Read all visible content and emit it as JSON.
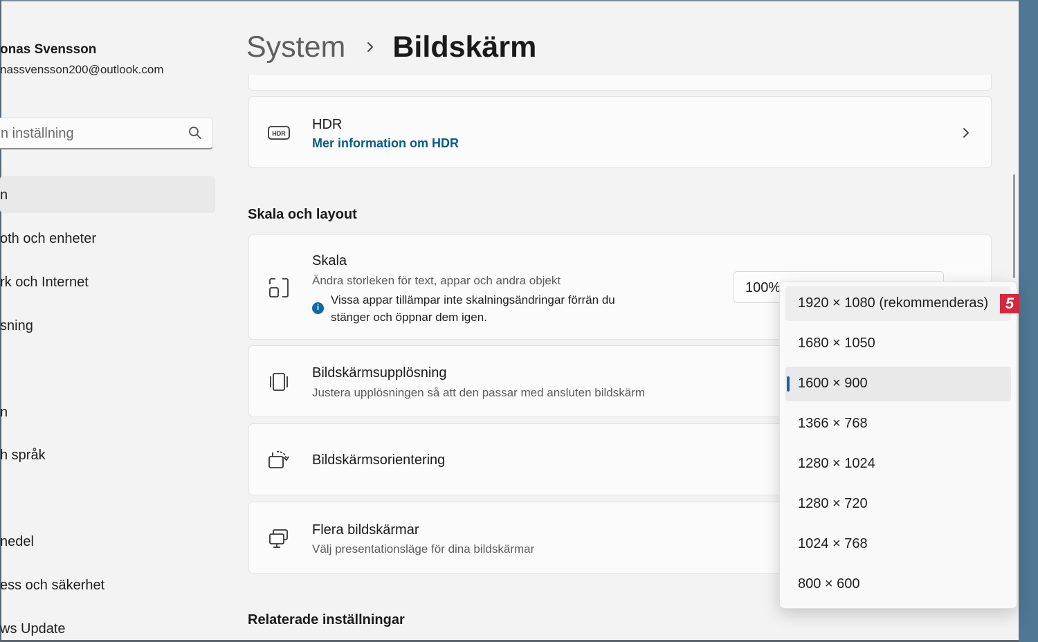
{
  "user": {
    "name": "onas Svensson",
    "email": "nassvensson200@outlook.com"
  },
  "search": {
    "placeholder": "n inställning",
    "icon": "search-icon"
  },
  "sidebar": {
    "items": [
      {
        "label": "n"
      },
      {
        "label": "oth och enheter"
      },
      {
        "label": "rk och Internet"
      },
      {
        "label": "sning"
      },
      {
        "label": "n"
      },
      {
        "label": "h språk"
      },
      {
        "label": "nedel"
      },
      {
        "label": "ess och säkerhet"
      },
      {
        "label": "ws Update"
      }
    ]
  },
  "header": {
    "parent": "System",
    "current": "Bildskärm"
  },
  "hdr_card": {
    "title": "HDR",
    "link": "Mer information om HDR",
    "icon": "hdr-icon"
  },
  "section_scale": {
    "title": "Skala och layout"
  },
  "scale_card": {
    "title": "Skala",
    "subtitle": "Ändra storleken för text, appar och andra objekt",
    "info_line1": "Vissa appar tillämpar inte skalningsändringar förrän du",
    "info_line2": "stänger och öppnar dem igen.",
    "value": "100%",
    "info_glyph": "i"
  },
  "resolution_card": {
    "title": "Bildskärmsupplösning",
    "subtitle": "Justera  upplösningen så att den passar med  ansluten bildskärm"
  },
  "orientation_card": {
    "title": "Bildskärmsorientering"
  },
  "multi_card": {
    "title": "Flera bildskärmar",
    "subtitle": "Välj presentationsläge för dina bildskärmar"
  },
  "section_related": {
    "title": "Relaterade inställningar"
  },
  "dropdown": {
    "options": [
      {
        "label": "1920 × 1080 (rekommenderas)"
      },
      {
        "label": "1680 × 1050"
      },
      {
        "label": "1600 × 900"
      },
      {
        "label": "1366 × 768"
      },
      {
        "label": "1280 × 1024"
      },
      {
        "label": "1280 × 720"
      },
      {
        "label": "1024 × 768"
      },
      {
        "label": "800 × 600"
      }
    ],
    "selected": "1600 × 900"
  },
  "badge": {
    "text": "5",
    "color": "#d7263d"
  },
  "colors": {
    "accent": "#0f6aa5",
    "link": "#0a5a8a"
  }
}
